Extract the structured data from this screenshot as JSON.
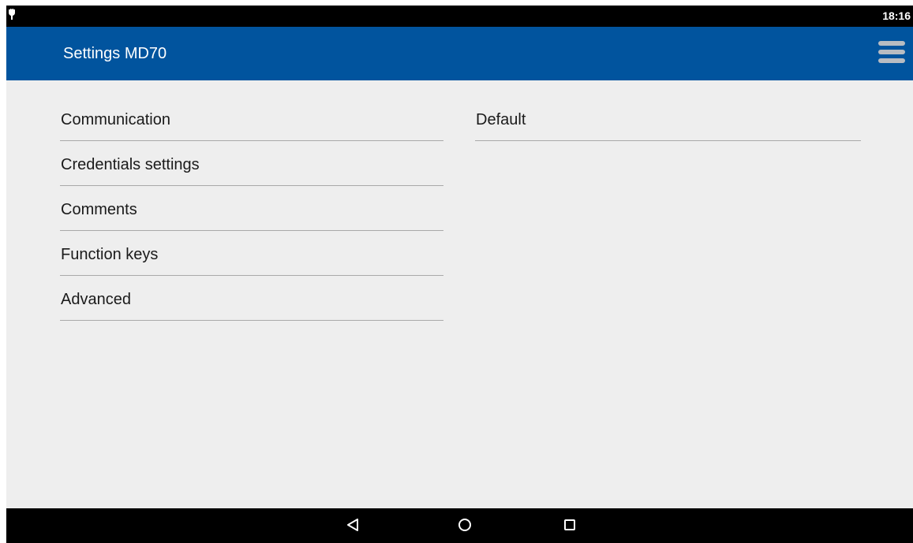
{
  "status_bar": {
    "time": "18:16",
    "left_icon": "usb-debug-icon"
  },
  "app_bar": {
    "title": "Settings MD70",
    "menu_icon": "hamburger-menu-icon"
  },
  "left_list": {
    "items": [
      {
        "label": "Communication"
      },
      {
        "label": "Credentials settings"
      },
      {
        "label": "Comments"
      },
      {
        "label": "Function keys"
      },
      {
        "label": "Advanced"
      }
    ]
  },
  "right_list": {
    "items": [
      {
        "label": "Default"
      }
    ]
  },
  "nav_bar": {
    "back_icon": "back-triangle-icon",
    "home_icon": "home-circle-icon",
    "recents_icon": "recents-square-icon"
  },
  "colors": {
    "app_bar": "#01549e",
    "background": "#eeeeee",
    "divider": "#a9a9a9"
  }
}
